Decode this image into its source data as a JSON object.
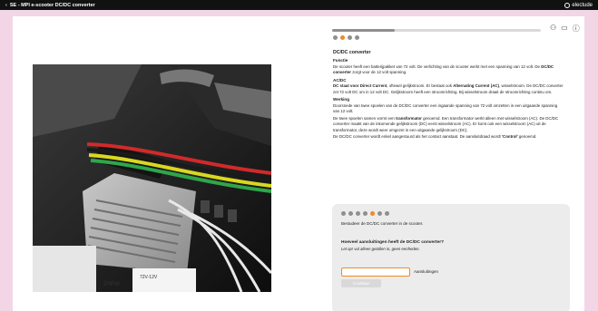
{
  "topbar": {
    "back_icon": "chevron-left-icon",
    "title": "SE - MPI e-scooter DC/DC converter",
    "brand": "electude"
  },
  "progress": {
    "fraction": 0.3
  },
  "top_steps": {
    "count": 4,
    "active": 1
  },
  "tools": {
    "icons": [
      "users-icon",
      "chat-icon",
      "help-icon"
    ]
  },
  "content": {
    "title": "DC/DC converter",
    "sections": [
      {
        "heading": "Functie",
        "paragraphs": [
          [
            {
              "t": "De scooter heeft een batterijpakket van 72 volt. De verlichting van de scooter werkt met een spanning van 12 volt. De "
            },
            {
              "t": "DC/DC converter",
              "b": true
            },
            {
              "t": " zorgt voor de 12 volt spanning."
            }
          ]
        ]
      },
      {
        "heading": "AC/DC",
        "paragraphs": [
          [
            {
              "t": "DC staat voor Direct Current",
              "b": true
            },
            {
              "t": ", oftewel gelijkstroom. Er bestaat ook "
            },
            {
              "t": "Alternating Current (AC)",
              "b": true
            },
            {
              "t": ", wisselstroom. De DC/DC converter zet 72 volt DC om in 12 volt DC. Gelijkstroom heeft een stroomrichting. Bij wisselstroom draait de stroomrichting continu om."
            }
          ]
        ]
      },
      {
        "heading": "Werking",
        "paragraphs": [
          [
            {
              "t": "Doorsnede van twee spoelen van de DC/DC converter een ingaande spanning van 72 volt omzetten in een uitgaande spanning van 12 volt."
            }
          ],
          [
            {
              "t": "De twee spoelen samen vormt een "
            },
            {
              "t": "transformator",
              "b": true
            },
            {
              "t": " genoemd. Een transformator werkt alleen met wisselstroom (AC). De DC/DC converter maakt van de inkomende gelijkstroom (DC) eerst wisselstroom (AC). Er komt ook een wisselstroom (AC) uit de transformator, deze wordt weer omgezet in een uitgaande gelijkstroom (DC)."
            }
          ],
          [
            {
              "t": "De DC/DC converter wordt enkel aangestuurd als het contact aanstaat. De aansluitdraad wordt "
            },
            {
              "t": "'Control'",
              "b": true
            },
            {
              "t": " genoemd."
            }
          ]
        ]
      }
    ]
  },
  "quiz": {
    "steps": {
      "count": 7,
      "active": 4
    },
    "instruction": "Bestudeer de DC/DC converter in de scooter.",
    "question": "Hoeveel aansluitingen heeft de DC/DC converter?",
    "hint": "Let op! vul alleen getallen in, geen eenheden.",
    "input_value": "",
    "input_placeholder": "",
    "unit_label": "Aansluitingen",
    "continue_label": "Continue"
  },
  "photo": {
    "label_text": "ZHRW",
    "sticker_text": "72V-12V"
  },
  "nav": {
    "prev_icon": "chevron-left-icon",
    "next_icon": "chevron-right-icon"
  },
  "bottom_tools": {
    "icons": [
      "eye-icon",
      "note-icon"
    ]
  },
  "colors": {
    "accent": "#f08a24",
    "background": "#f2d6e6",
    "topbar": "#111111"
  }
}
